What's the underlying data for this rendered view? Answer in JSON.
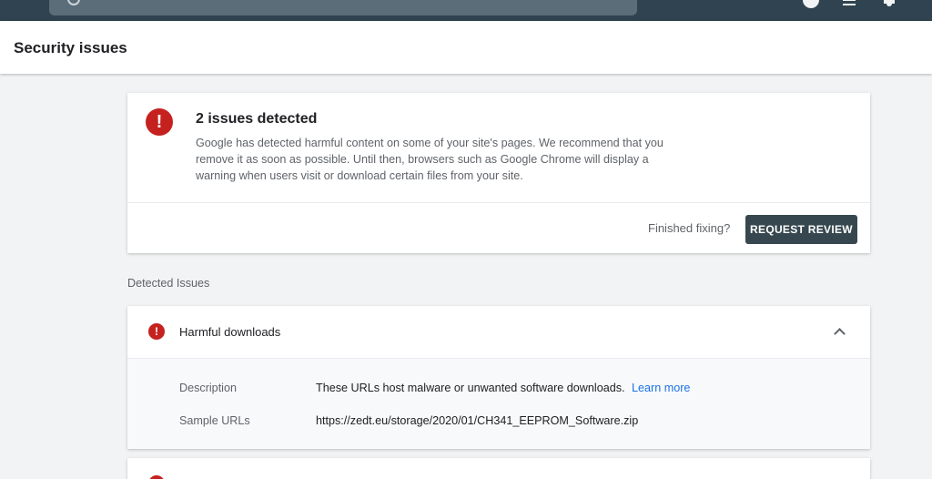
{
  "topbar": {
    "search_placeholder": "(partially hidden)",
    "icons": [
      "search-icon",
      "help-icon",
      "swap-icon",
      "bell-icon"
    ]
  },
  "header": {
    "title": "Security issues"
  },
  "summary": {
    "heading": "2 issues detected",
    "description": "Google has detected harmful content on some of your site's pages. We recommend that you remove it as soon as possible. Until then, browsers such as Google Chrome will display a warning when users visit or download certain files from your site.",
    "finished_label": "Finished fixing?",
    "button_label": "REQUEST REVIEW"
  },
  "section_label": "Detected Issues",
  "issues": [
    {
      "title": "Harmful downloads",
      "rows": [
        {
          "label": "Description",
          "value": "These URLs host malware or unwanted software downloads.",
          "link": "Learn more"
        },
        {
          "label": "Sample URLs",
          "value": "https://zedt.eu/storage/2020/01/CH341_EEPROM_Software.zip"
        }
      ]
    }
  ],
  "colors": {
    "topbar": "#2f4350",
    "alert": "#c5221f",
    "button": "#37474f",
    "link": "#1a73e8"
  }
}
